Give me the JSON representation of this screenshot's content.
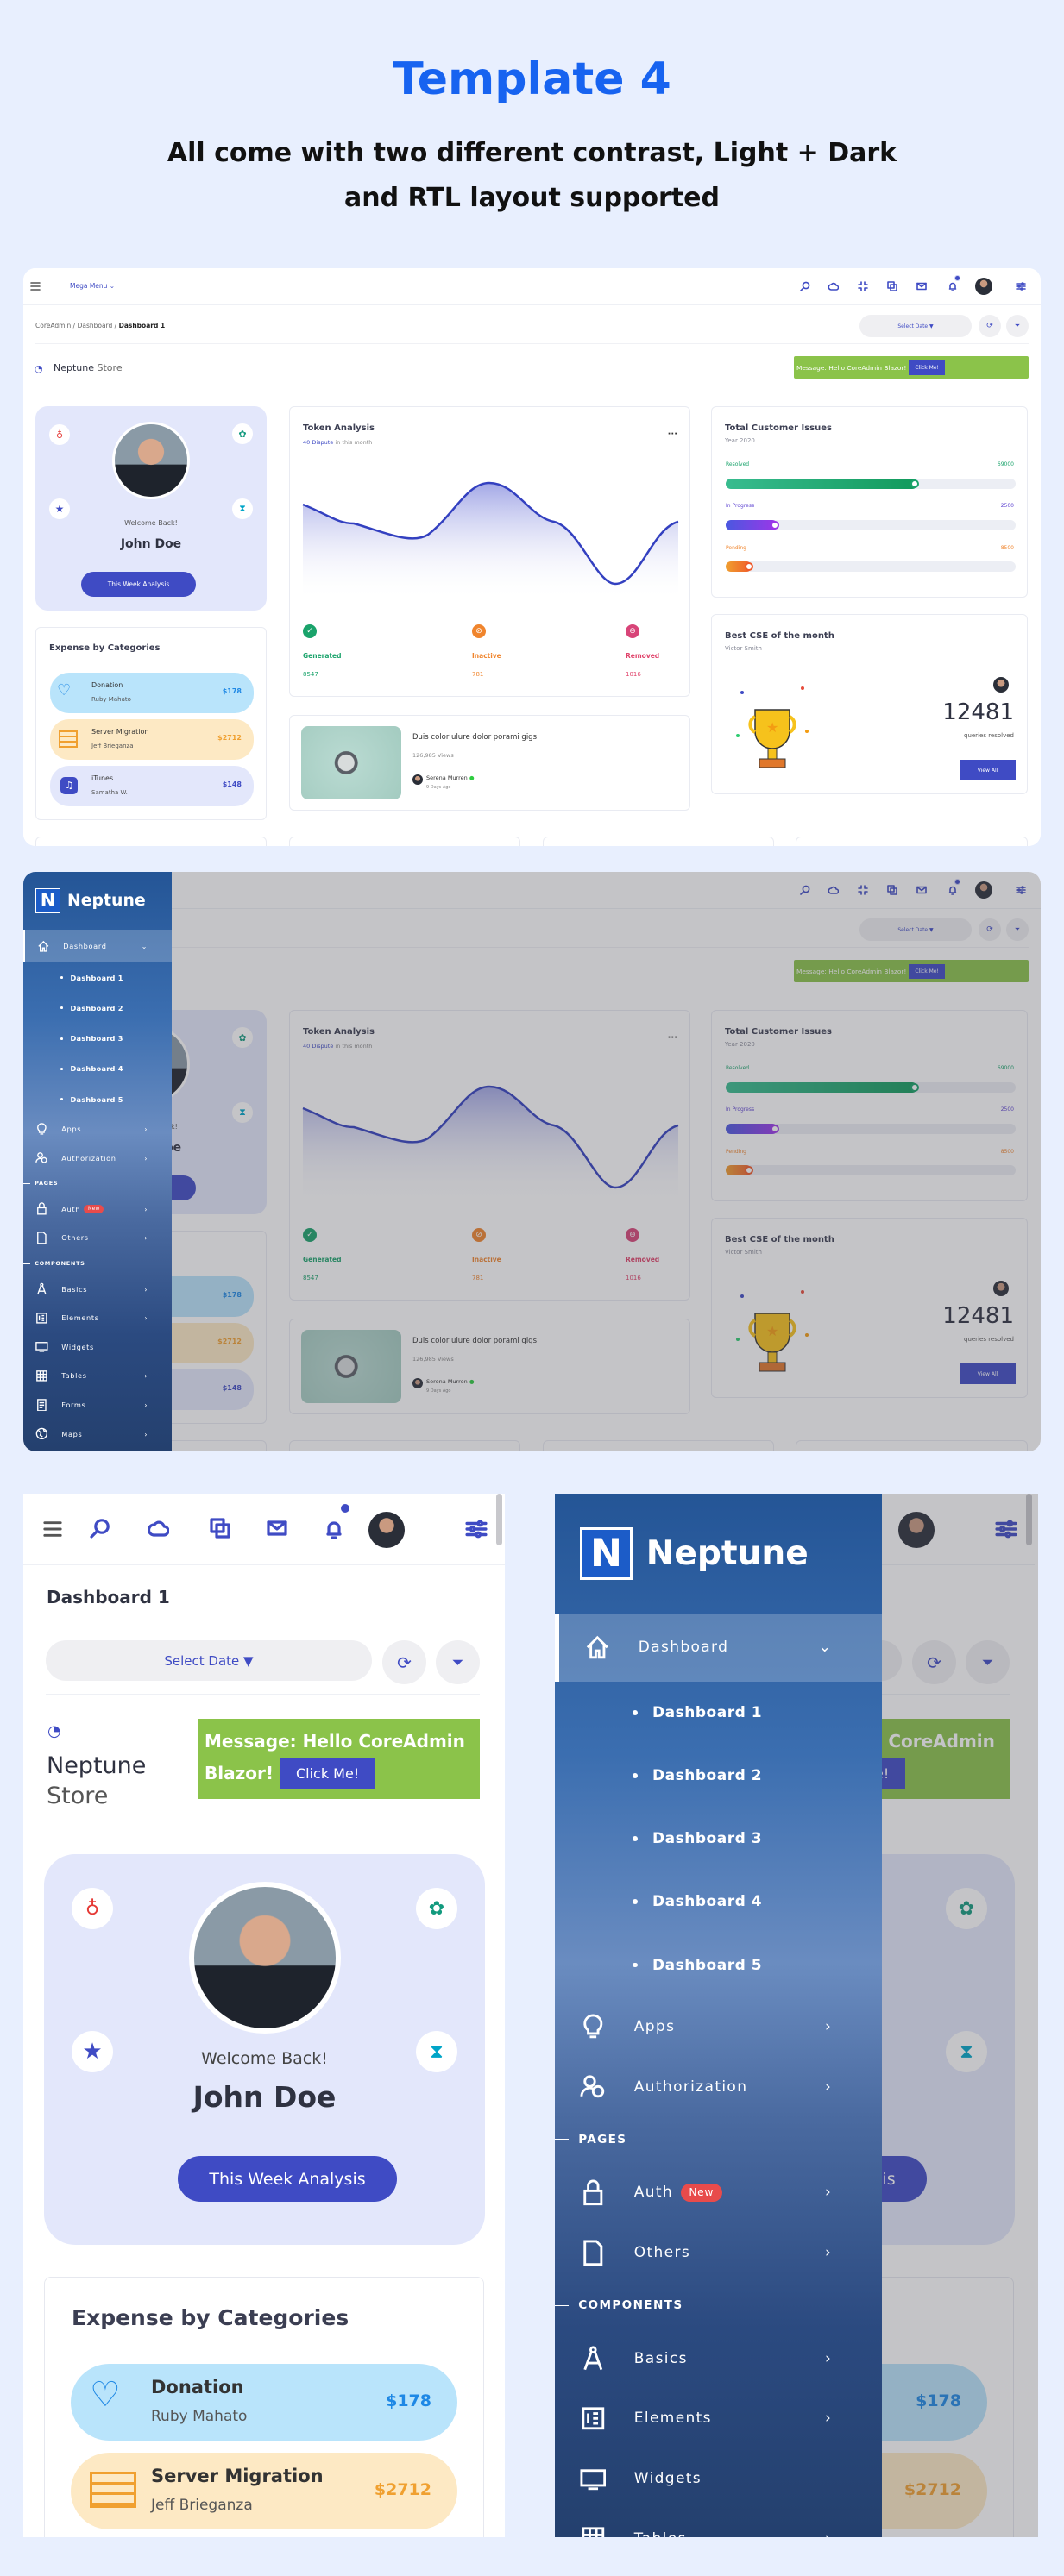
{
  "header": {
    "title": "Template 4",
    "subtitle_line1": "All come with two different contrast, Light + Dark",
    "subtitle_line2": "and RTL layout supported"
  },
  "topbar": {
    "mega_menu": "Mega Menu ⌄",
    "icons": [
      "menu-icon",
      "search-icon",
      "cloud-icon",
      "fullscreen-icon",
      "translate-icon",
      "mail-icon",
      "bell-icon",
      "avatar",
      "settings-sliders-icon"
    ]
  },
  "breadcrumb": {
    "items": [
      "CoreAdmin",
      "Dashboard",
      "Dashboard 1"
    ],
    "separator": "/"
  },
  "page_title": "Dashboard 1",
  "toolbar": {
    "select_date": "Select Date ▼"
  },
  "store": {
    "name": "Neptune",
    "suffix": "Store"
  },
  "message": {
    "text": "Message: Hello CoreAdmin Blazor!",
    "text_line1": "Message: Hello CoreAdmin",
    "text_line2": "Blazor!",
    "button": "Click Me!"
  },
  "profile": {
    "welcome": "Welcome Back!",
    "name": "John Doe",
    "button": "This Week Analysis"
  },
  "expense": {
    "title": "Expense by Categories",
    "items": [
      {
        "title": "Donation",
        "person": "Ruby Mahato",
        "amount": "$178",
        "color": "#b9e4fb",
        "accent": "#1e88e5"
      },
      {
        "title": "Server Migration",
        "person": "Jeff Brieganza",
        "amount": "$2712",
        "color": "#fde9c4",
        "accent": "#f0a030"
      },
      {
        "title": "iTunes",
        "person": "Samatha W.",
        "amount": "$148",
        "color": "#e3e7fb",
        "accent": "#3f4bc4"
      }
    ]
  },
  "token": {
    "title": "Token Analysis",
    "dispute": "40 Dispute",
    "subtitle_rest": "in this month",
    "menu": "···",
    "stats": [
      {
        "label": "Generated",
        "value": "8547",
        "color": "#1aa36b"
      },
      {
        "label": "Inactive",
        "value": "781",
        "color": "#f0852d"
      },
      {
        "label": "Removed",
        "value": "1016",
        "color": "#e0436b"
      }
    ]
  },
  "video": {
    "title": "Duis color ulure dolor porami gigs",
    "views": "126,985 Views",
    "author": "Serena Murren",
    "time": "9 Days Ago"
  },
  "issues": {
    "title": "Total Customer Issues",
    "year": "Year 2020",
    "rows": [
      {
        "label": "Resolved",
        "value": "69000",
        "progress": 66,
        "color": "#1aa36b"
      },
      {
        "label": "In Progress",
        "value": "2500",
        "progress": 18,
        "color": "#7b3fe4"
      },
      {
        "label": "Pending",
        "value": "8500",
        "progress": 9,
        "color": "#f07a2d"
      }
    ]
  },
  "cse": {
    "title": "Best CSE of the month",
    "name": "Victor Smith",
    "count": "12481",
    "caption": "queries resolved",
    "button": "View All"
  },
  "sidebar": {
    "brand": "Neptune",
    "logo_letter": "N",
    "items": {
      "dashboard": "Dashboard",
      "d1": "Dashboard 1",
      "d2": "Dashboard 2",
      "d3": "Dashboard 3",
      "d4": "Dashboard 4",
      "d5": "Dashboard 5",
      "apps": "Apps",
      "authorization": "Authorization",
      "pages": "PAGES",
      "auth": "Auth",
      "auth_badge": "New",
      "others": "Others",
      "components": "COMPONENTS",
      "basics": "Basics",
      "elements": "Elements",
      "widgets": "Widgets",
      "tables": "Tables",
      "forms": "Forms",
      "maps": "Maps"
    }
  },
  "colors": {
    "primary": "#3f4bc4",
    "title_blue": "#1763f0",
    "message_green": "#8bc34a",
    "background": "#e8effe"
  }
}
